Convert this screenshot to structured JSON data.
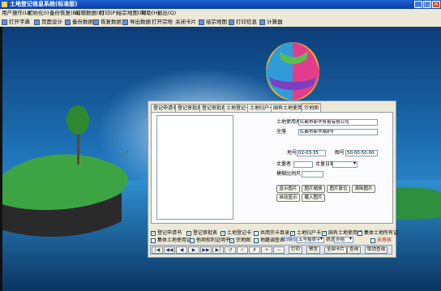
{
  "window": {
    "title": "土地登记信息系统(标准版)",
    "buttons": [
      "_",
      "□",
      "×"
    ]
  },
  "menu": [
    "用户操作(U)",
    "初始化(I)",
    "备份恢复(B)",
    "编辑数据(E)",
    "打印(P)",
    "绘宗地图(D)",
    "帮助(H)",
    "退出(Q)"
  ],
  "toolbar": [
    "打开字典",
    "页面设计",
    "备份数据",
    "恢复数据",
    "导出数据",
    "打开宗地",
    "关闭卡片",
    "绘宗地图",
    "打印信息",
    "计算器"
  ],
  "tabs": [
    "登记申请书",
    "登记审批表1",
    "登记审批表2",
    "土地登记卡",
    "土地归户卡",
    "国有土地使用证",
    "宗地图"
  ],
  "form": {
    "land_user_label": "土地使用者",
    "land_user_value": "红都市新华贸易有限公司",
    "location_label": "坐落",
    "location_value": "红都市新华路8号",
    "parcel_no_label": "地号",
    "parcel_no_value": "02-03-35",
    "map_no_label": "图号",
    "map_no_value": "50.00-50.00",
    "surveyor_label": "丈量者",
    "survey_date_label": "丈量日期",
    "survey_date_value": "",
    "scale_label": "模糊比例尺"
  },
  "image_buttons": [
    [
      "显示图片",
      "图片缩放",
      "图片复位",
      "清除图片"
    ],
    [
      "自动显示",
      "载入图片"
    ]
  ],
  "checkboxes_row1": [
    {
      "label": "登记申请书",
      "checked": true
    },
    {
      "label": "登记审批表",
      "checked": true
    },
    {
      "label": "土地登记卡",
      "checked": true
    },
    {
      "label": "共用宗卡目录",
      "checked": false
    },
    {
      "label": "土地归户卡",
      "checked": true
    },
    {
      "label": "国有土地使用证",
      "checked": true
    },
    {
      "label": "集体土地所有证",
      "checked": false
    }
  ],
  "checkboxes_row2": [
    {
      "label": "集体土地使用证",
      "checked": false
    },
    {
      "label": "他项权利证明书",
      "checked": false
    },
    {
      "label": "宗地图",
      "checked": true
    },
    {
      "label": "地籍调查表",
      "checked": false
    }
  ],
  "row2_extra": {
    "label_blue": "扫描仪",
    "font_value": "五号楷体字",
    "status_label": "状态",
    "status_value": "办结",
    "unreviewed_label": "未审核"
  },
  "navbar": {
    "buttons": [
      "|◀",
      "◀◀",
      "◀",
      "▶",
      "▶▶",
      "▶|",
      "↺",
      "✓",
      "✗",
      "+",
      "−"
    ],
    "print": "打印",
    "preview": "预览",
    "all_cards": "全部卡片",
    "search": "查询",
    "cancel_search": "取消查询"
  }
}
